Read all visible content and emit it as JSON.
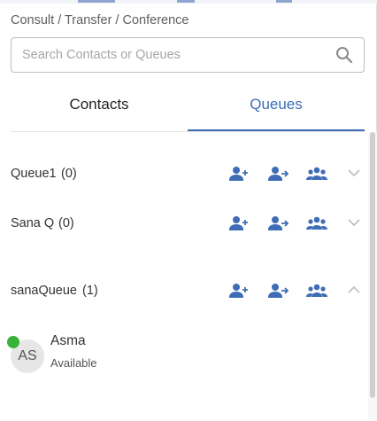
{
  "header": {
    "title": "Consult / Transfer / Conference"
  },
  "search": {
    "placeholder": "Search Contacts or Queues",
    "value": ""
  },
  "tabs": [
    {
      "label": "Contacts",
      "active": false
    },
    {
      "label": "Queues",
      "active": true
    }
  ],
  "queues": [
    {
      "name": "Queue1",
      "count": "(0)",
      "expanded": false
    },
    {
      "name": "Sana Q",
      "count": "(0)",
      "expanded": false
    },
    {
      "name": "sanaQueue",
      "count": "(1)",
      "expanded": true
    }
  ],
  "queue_actions": {
    "consult_icon": "person-add-icon",
    "transfer_icon": "person-transfer-icon",
    "conference_icon": "group-icon"
  },
  "agents": [
    {
      "initials": "AS",
      "name": "Asma",
      "status": "Available",
      "status_color": "#36b336"
    }
  ],
  "colors": {
    "accent": "#3e6db5",
    "icon": "#3e6db5",
    "online": "#36b336"
  }
}
